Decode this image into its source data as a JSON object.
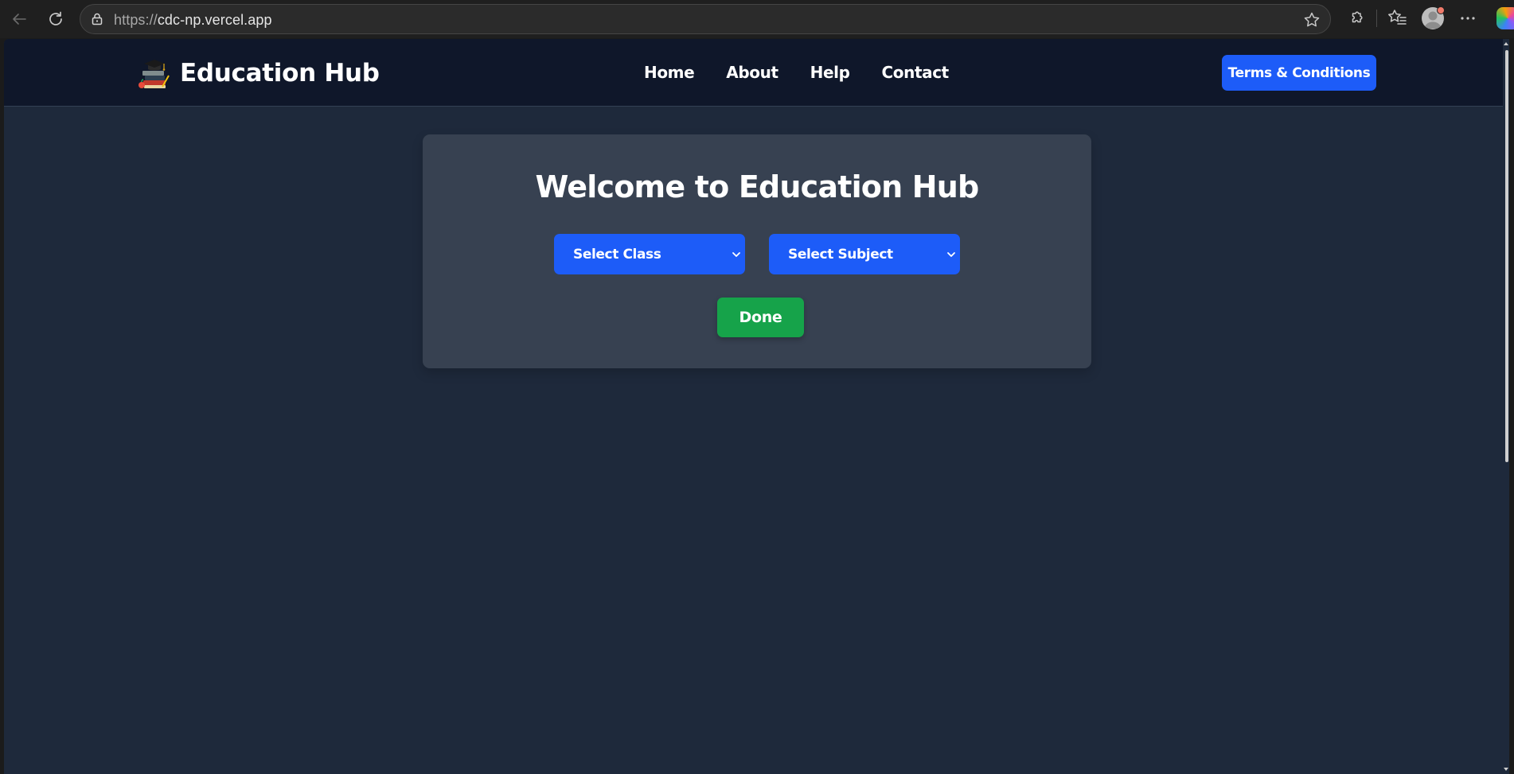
{
  "browser": {
    "url_scheme": "https://",
    "url_host": "cdc-np.vercel.app",
    "icons": [
      "back-icon",
      "reload-icon",
      "lock-icon",
      "star-icon",
      "extensions-icon",
      "favorites-icon",
      "profile-avatar",
      "more-menu-icon",
      "copilot-icon"
    ]
  },
  "header": {
    "brand_name": "Education Hub",
    "logo_icon": "books-graduation-cap-icon",
    "nav": [
      {
        "label": "Home"
      },
      {
        "label": "About"
      },
      {
        "label": "Help"
      },
      {
        "label": "Contact"
      }
    ],
    "terms_label": "Terms & Conditions"
  },
  "main": {
    "title": "Welcome to Education Hub",
    "class_select": {
      "selected": "Select Class"
    },
    "subject_select": {
      "selected": "Select Subject"
    },
    "done_label": "Done"
  },
  "colors": {
    "page_bg": "#1e293b",
    "header_bg": "#0f172a",
    "card_bg": "#374151",
    "primary_blue": "#1d5cf8",
    "done_green": "#16a34a"
  }
}
